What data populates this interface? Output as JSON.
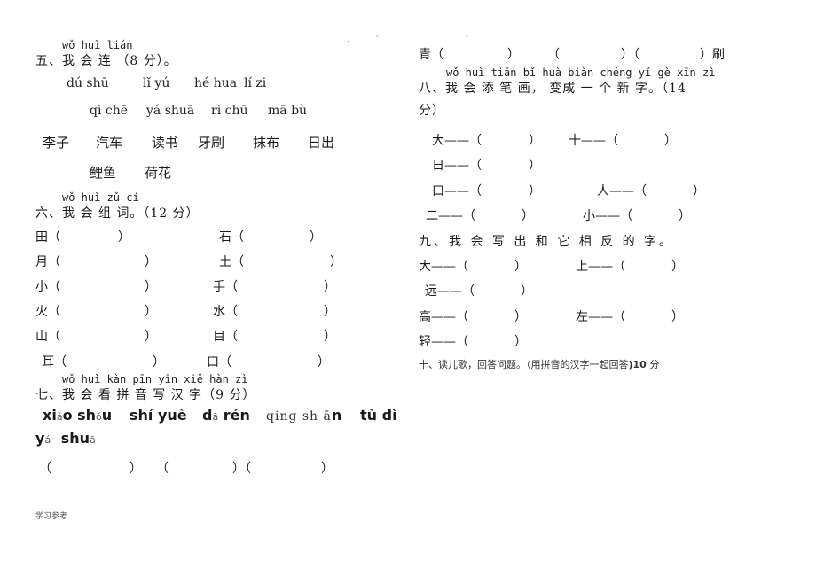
{
  "section5": {
    "pinyin": "wǒ huì lián",
    "title": "五、我 会  连 （8 分）。",
    "pinyin_row1": [
      "dú shū",
      "lǐ yú",
      "hé hua",
      "lí zi"
    ],
    "pinyin_row2": [
      "qì chē",
      "yá shuā",
      "rì chū",
      "mā bù"
    ],
    "words_row1": [
      "李子",
      "汽车",
      "读书",
      "牙刷",
      "抹布",
      "日出"
    ],
    "words_row2": [
      "鲤鱼",
      "荷花"
    ]
  },
  "section6": {
    "pinyin": "wǒ huì zǔ cí",
    "title": "六、我 会 组 词。（12 分）",
    "left_items": [
      "田（",
      "月（",
      "小（",
      "火（",
      "山（",
      "耳（"
    ],
    "right_items": [
      "石（",
      "土（",
      "手（",
      "水（",
      "目（",
      "口（"
    ],
    "close": "）"
  },
  "section7": {
    "pinyin": "wǒ huì kàn pīn yīn xiě hàn zì",
    "title": "七、我 会 看 拼 音 写 汉 字（9 分）",
    "words": [
      {
        "parts": [
          [
            "xi",
            "b"
          ],
          [
            "ǎ",
            "l"
          ],
          [
            "o sh",
            "b"
          ],
          [
            "ǒ",
            "l"
          ],
          [
            "u",
            "b"
          ]
        ]
      },
      {
        "parts": [
          [
            "shí yuè",
            "b"
          ]
        ]
      },
      {
        "parts": [
          [
            "d",
            "b"
          ],
          [
            "ā",
            "l"
          ],
          [
            " rén",
            "b"
          ]
        ]
      },
      {
        "parts": [
          [
            "qing sh ā",
            "s"
          ],
          [
            "n",
            "b"
          ]
        ]
      },
      {
        "parts": [
          [
            "tù dì",
            "b"
          ]
        ]
      },
      {
        "parts": [
          [
            "y",
            "b"
          ],
          [
            "á",
            "l"
          ],
          [
            "  shu",
            "b"
          ],
          [
            "ā",
            "l"
          ]
        ]
      }
    ],
    "brackets": [
      "（",
      "）",
      "（",
      "）（",
      "）"
    ]
  },
  "right_top": {
    "line": [
      "青（",
      "）",
      "（",
      "）（",
      "）刷"
    ]
  },
  "section8": {
    "pinyin": "wǒ huì tiān bǐ huà  biàn chéng yí gè xīn zì",
    "title": "八、我 会  添 笔 画， 变成  一 个 新  字。（14",
    "title_cont": "分）",
    "rows": [
      [
        "大——（",
        "）",
        "十——（",
        "）"
      ],
      [
        "日——（",
        "）",
        "",
        ""
      ],
      [
        "口——（",
        "）",
        "人——（",
        "）"
      ],
      [
        "二——（",
        "）",
        "小——（",
        "）"
      ]
    ]
  },
  "section9": {
    "title": "九、我 会 写 出 和 它 相 反 的 字。",
    "rows": [
      [
        "大——（",
        "）",
        "上——（",
        "）"
      ],
      [
        "远——（",
        "）",
        "",
        ""
      ],
      [
        "高——（",
        "）",
        "左——（",
        "）"
      ],
      [
        "轻——（",
        "）",
        "",
        ""
      ]
    ]
  },
  "section10": {
    "title": "十、读儿歌，回答问题。（用拼音的汉字一起回答",
    "score": ")10",
    "unit": " 分"
  },
  "footer": {
    "text": "学习参考"
  }
}
